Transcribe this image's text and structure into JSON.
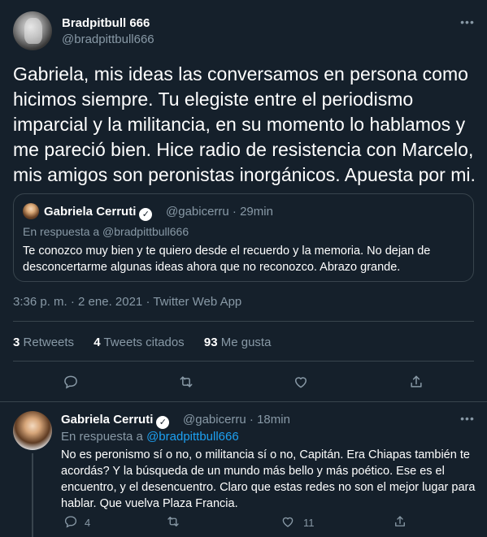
{
  "main_tweet": {
    "name": "Bradpitbull 666",
    "handle": "@bradpittbull666",
    "more_icon": "more-horizontal-icon",
    "text": "Gabriela, mis ideas las conversamos en persona como hicimos siempre. Tu elegiste entre el periodismo imparcial y la militancia, en su momento lo hablamos y me pareció bien. Hice radio de resistencia con Marcelo, mis amigos son peronistas inorgánicos. Apuesta por mi.",
    "timestamp": "3:36 p. m. · 2 ene. 2021 · Twitter Web App",
    "stats": {
      "retweets_count": "3",
      "retweets_label": "Retweets",
      "quotes_count": "4",
      "quotes_label": "Tweets citados",
      "likes_count": "93",
      "likes_label": "Me gusta"
    }
  },
  "quoted_tweet": {
    "name": "Gabriela Cerruti",
    "verified": "✓",
    "handle_time": "@gabicerru · 29min",
    "reply_to": "En respuesta a @bradpittbull666",
    "text": "Te conozco muy bien y te quiero desde el recuerdo y la memoria. No dejan de desconcertarme algunas ideas ahora que no reconozco. Abrazo grande."
  },
  "reply_tweet": {
    "name": "Gabriela Cerruti",
    "verified": "✓",
    "handle_time": "@gabicerru · 18min",
    "reply_prefix": "En respuesta a",
    "reply_handle": "@bradpittbull666",
    "text": "No es peronismo sí o no, o militancia sí o no, Capitán. Era Chiapas también te acordás? Y la búsqueda de un mundo más bello y más poético. Ese es el encuentro, y el desencuentro. Claro que estas redes no son el mejor lugar para hablar. Que vuelva Plaza Francia.",
    "reply_count": "4",
    "like_count": "11"
  },
  "colors": {
    "background": "#15202b",
    "border": "#38444d",
    "muted": "#8899a6",
    "link": "#1da1f2",
    "text": "#ffffff"
  }
}
